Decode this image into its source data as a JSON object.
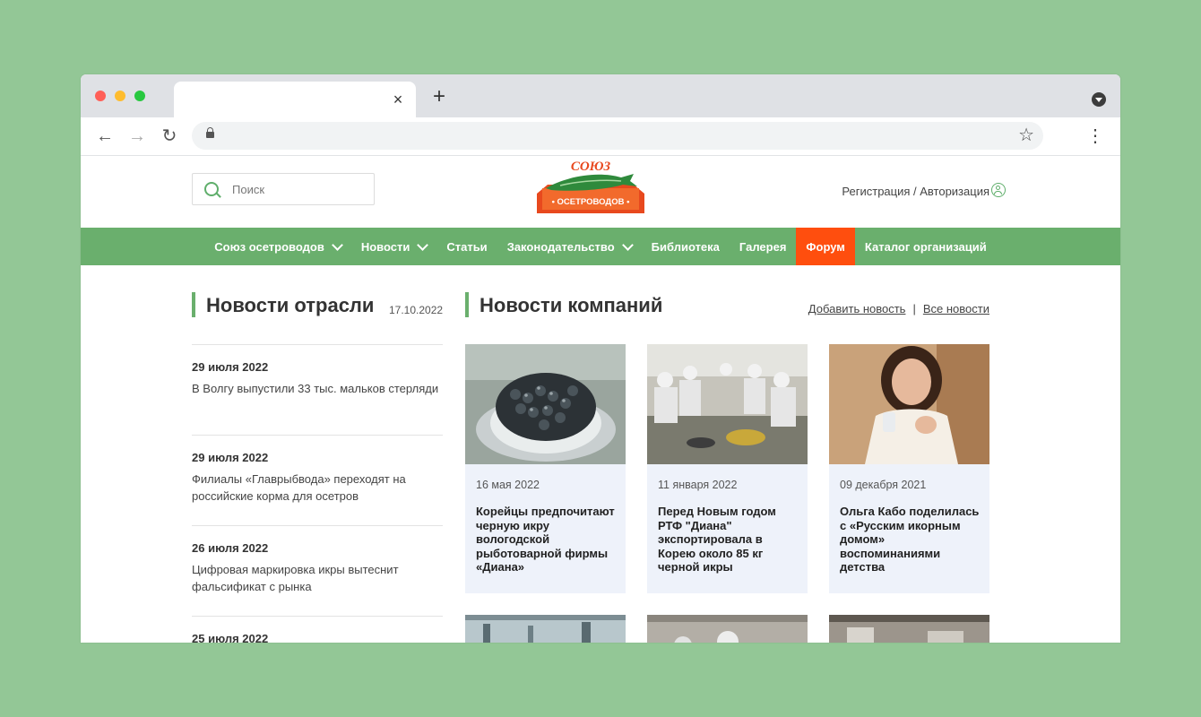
{
  "browser": {
    "tab_close": "×",
    "new_tab": "+",
    "back": "←",
    "forward": "→",
    "reload": "↻",
    "star": "☆",
    "menu": "⋮"
  },
  "header": {
    "search_placeholder": "Поиск",
    "logo_top": "СОЮЗ",
    "logo_bottom": "• ОСЕТРОВОДОВ •",
    "auth": "Регистрация / Авторизация"
  },
  "nav": {
    "items": [
      {
        "label": "Союз осетроводов",
        "dropdown": true
      },
      {
        "label": "Новости",
        "dropdown": true
      },
      {
        "label": "Статьи",
        "dropdown": false
      },
      {
        "label": "Законодательство",
        "dropdown": true
      },
      {
        "label": "Библиотека",
        "dropdown": false
      },
      {
        "label": "Галерея",
        "dropdown": false
      },
      {
        "label": "Форум",
        "dropdown": false,
        "active": true
      },
      {
        "label": "Каталог организаций",
        "dropdown": false
      }
    ],
    "active_color": "#ff4e0e",
    "bar_color": "#6aaf6d"
  },
  "industry_news": {
    "title": "Новости отрасли",
    "date": "17.10.2022",
    "items": [
      {
        "date": "29 июля 2022",
        "text": "В Волгу выпустили 33 тыс. мальков стерляди"
      },
      {
        "date": "29 июля 2022",
        "text": "Филиалы «Главрыбвода» переходят на российские корма для осетров"
      },
      {
        "date": "26 июля 2022",
        "text": "Цифровая маркировка икры вытеснит фальсификат с рынка"
      },
      {
        "date": "25 июля 2022",
        "text": ""
      }
    ]
  },
  "company_news": {
    "title": "Новости компаний",
    "add_link": "Добавить новость",
    "separator": "|",
    "all_link": "Все новости",
    "cards": [
      {
        "date": "16 мая 2022",
        "title": "Корейцы предпочитают черную икру вологодской рыботоварной фирмы «Диана»"
      },
      {
        "date": "11 января 2022",
        "title": "Перед Новым годом РТФ \"Диана\" экспортировала в Корею около 85 кг черной икры"
      },
      {
        "date": "09 декабря 2021",
        "title": "Ольга Кабо поделилась с «Русским икорным домом» воспоминаниями детства"
      }
    ]
  }
}
